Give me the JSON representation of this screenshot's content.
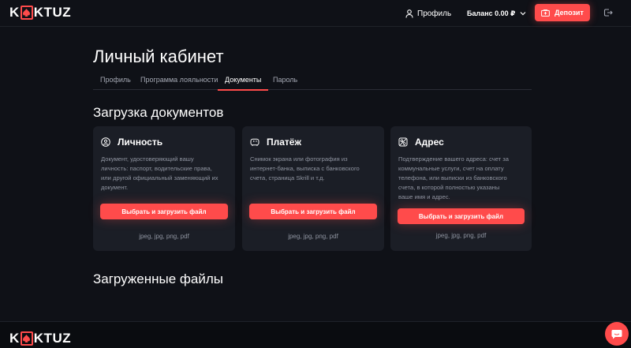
{
  "header": {
    "logo_left": "K",
    "logo_right": "KTUZ",
    "profile_label": "Профиль",
    "balance_label": "Баланс 0.00 ₽",
    "deposit_label": "Депозит"
  },
  "page": {
    "title": "Личный кабинет",
    "tabs": [
      {
        "label": "Профиль",
        "active": false
      },
      {
        "label": "Программа лояльности",
        "active": false
      },
      {
        "label": "Документы",
        "active": true
      },
      {
        "label": "Пароль",
        "active": false
      }
    ]
  },
  "upload_section": {
    "title": "Загрузка документов",
    "cards": [
      {
        "title": "Личность",
        "icon": "identity-icon",
        "description": [
          "Документ, удостоверяющий вашу",
          "личность: паспорт, водительские права,",
          "или другой официальный заменяющий их",
          "документ."
        ],
        "button": "Выбрать и загрузить файл",
        "formats": "jpeg, jpg, png, pdf"
      },
      {
        "title": "Платёж",
        "icon": "payment-icon",
        "description": [
          "Снимок экрана или фотография из",
          "интернет-банка, выписка с банковского",
          "счета, страница Skrill и т.д."
        ],
        "button": "Выбрать и загрузить файл",
        "formats": "jpeg, jpg, png, pdf"
      },
      {
        "title": "Адрес",
        "icon": "address-icon",
        "description": [
          "Подтверждение вашего адреса: счет за",
          "коммунальные услуги, счет на оплату",
          "телефона, или выписки из банковского",
          "счета, в которой полностью указаны",
          "ваше имя и адрес."
        ],
        "button": "Выбрать и загрузить файл",
        "formats": "jpeg, jpg, png, pdf"
      }
    ]
  },
  "uploaded_section": {
    "title": "Загруженные файлы"
  },
  "colors": {
    "accent": "#ff4b4b",
    "background": "#0f1117",
    "card": "#1b1e26",
    "muted_text": "#8f94a0"
  }
}
